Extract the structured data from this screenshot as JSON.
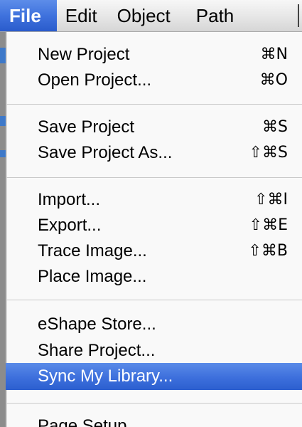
{
  "menubar": {
    "file_label": "File",
    "edit_label": "Edit",
    "object_label": "Object",
    "path_label": "Path"
  },
  "file_menu": {
    "items": [
      {
        "label": "New Project",
        "shortcut": "⌘N"
      },
      {
        "label": "Open Project...",
        "shortcut": "⌘O"
      },
      {
        "label": "Save Project",
        "shortcut": "⌘S"
      },
      {
        "label": "Save Project As...",
        "shortcut": "⇧⌘S"
      },
      {
        "label": "Import...",
        "shortcut": "⇧⌘I"
      },
      {
        "label": "Export...",
        "shortcut": "⇧⌘E"
      },
      {
        "label": "Trace Image...",
        "shortcut": "⇧⌘B"
      },
      {
        "label": "Place Image...",
        "shortcut": ""
      },
      {
        "label": "eShape Store...",
        "shortcut": ""
      },
      {
        "label": "Share Project...",
        "shortcut": ""
      },
      {
        "label": "Sync My Library...",
        "shortcut": ""
      },
      {
        "label": "Page Setup...",
        "shortcut": ""
      }
    ],
    "highlighted_item": "Sync My Library..."
  },
  "colors": {
    "selection": "#3d6fdc",
    "menu_background": "#f9f9f9",
    "window_edge_accent": "#3e79c9"
  }
}
